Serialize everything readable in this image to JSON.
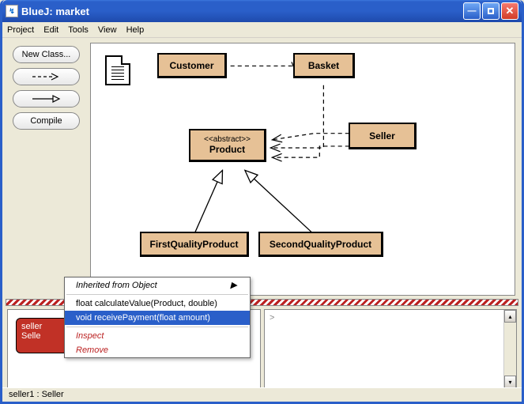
{
  "window": {
    "title": "BlueJ:  market"
  },
  "menubar": [
    "Project",
    "Edit",
    "Tools",
    "View",
    "Help"
  ],
  "sidebar": {
    "newclass": "New Class...",
    "compile": "Compile"
  },
  "classes": {
    "customer": "Customer",
    "basket": "Basket",
    "product_stereo": "<<abstract>>",
    "product": "Product",
    "seller": "Seller",
    "first": "FirstQualityProduct",
    "second": "SecondQualityProduct"
  },
  "objectbench": {
    "obj1_line1": "seller",
    "obj1_line2": "Selle"
  },
  "ctx": {
    "inherited": "Inherited from Object",
    "calc": "float calculateValue(Product, double)",
    "receive": "void receivePayment(float amount)",
    "inspect": "Inspect",
    "remove": "Remove"
  },
  "codesnip": {
    "prompt": ">"
  },
  "statusbar": {
    "text": "seller1 : Seller"
  },
  "arrow_char": "▶"
}
